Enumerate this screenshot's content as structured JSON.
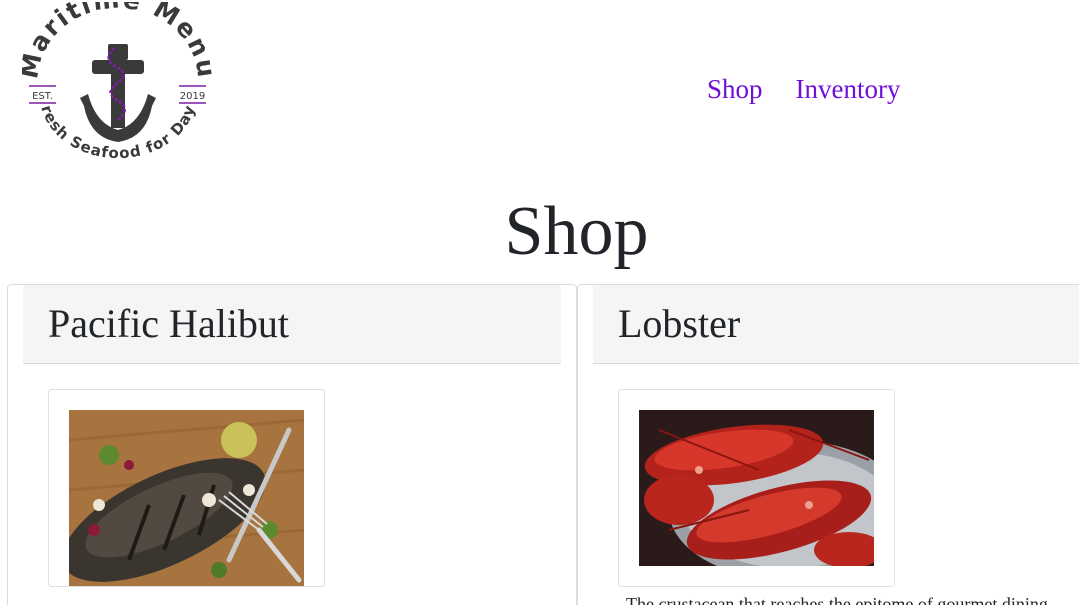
{
  "brand": {
    "name": "Maritime Menu",
    "est_label": "EST.",
    "est_year": "2019",
    "tagline": "Fresh Seafood for Days",
    "accent_color": "#7b1fa2",
    "logo_color": "#3a3a3a"
  },
  "nav": {
    "items": [
      {
        "label": "Shop"
      },
      {
        "label": "Inventory"
      }
    ],
    "link_color": "#6f10d8"
  },
  "page": {
    "title": "Shop"
  },
  "products": [
    {
      "name": "Pacific Halibut",
      "image_icon": "grilled-fish-photo",
      "description": ""
    },
    {
      "name": "Lobster",
      "image_icon": "lobster-photo",
      "description": "The crustacean that reaches the epitome of gourmet dining"
    }
  ]
}
